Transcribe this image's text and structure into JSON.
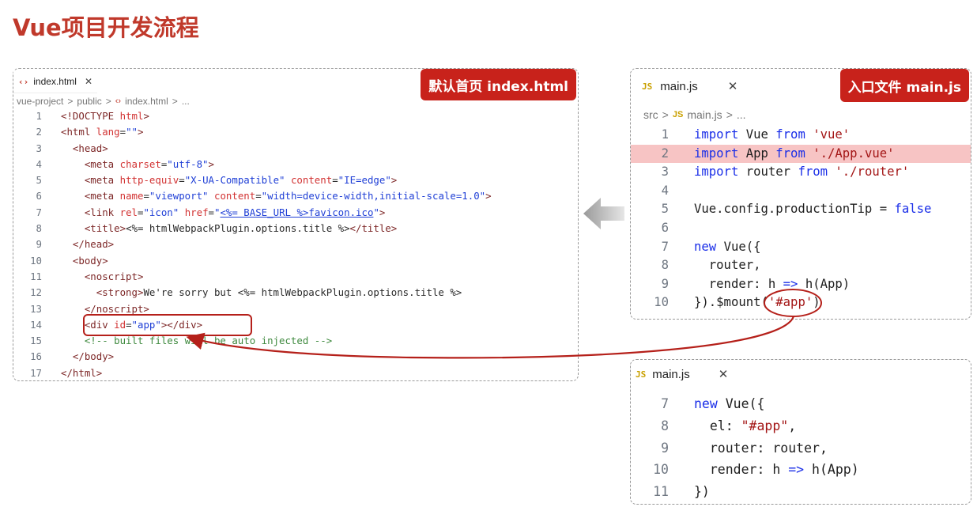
{
  "page_title": "Vue项目开发流程",
  "colors": {
    "accent": "#c8221b",
    "keyword": "#1a2ee8",
    "string": "#a31515",
    "comment": "#3f8a3f",
    "highlight": "#f7c4c4"
  },
  "left_panel": {
    "tab": {
      "icon": "‹›",
      "label": "index.html",
      "close": "✕"
    },
    "badge": "默认首页 index.html",
    "breadcrumb": [
      "vue-project",
      ">",
      "public",
      ">",
      "‹›",
      "index.html",
      ">",
      "..."
    ],
    "lines": [
      {
        "n": "1",
        "parts": [
          {
            "c": "c-tag",
            "t": "<!DOCTYPE "
          },
          {
            "c": "c-attr",
            "t": "html"
          },
          {
            "c": "c-tag",
            "t": ">"
          }
        ]
      },
      {
        "n": "2",
        "parts": [
          {
            "c": "c-tag",
            "t": "<html "
          },
          {
            "c": "c-attr",
            "t": "lang"
          },
          {
            "c": "c-txt",
            "t": "="
          },
          {
            "c": "c-str",
            "t": "\"\""
          },
          {
            "c": "c-tag",
            "t": ">"
          }
        ]
      },
      {
        "n": "3",
        "parts": [
          {
            "c": "c-tag",
            "t": "  <head>"
          }
        ]
      },
      {
        "n": "4",
        "parts": [
          {
            "c": "c-tag",
            "t": "    <meta "
          },
          {
            "c": "c-attr",
            "t": "charset"
          },
          {
            "c": "c-txt",
            "t": "="
          },
          {
            "c": "c-str",
            "t": "\"utf-8\""
          },
          {
            "c": "c-tag",
            "t": ">"
          }
        ]
      },
      {
        "n": "5",
        "parts": [
          {
            "c": "c-tag",
            "t": "    <meta "
          },
          {
            "c": "c-attr",
            "t": "http-equiv"
          },
          {
            "c": "c-txt",
            "t": "="
          },
          {
            "c": "c-str",
            "t": "\"X-UA-Compatible\" "
          },
          {
            "c": "c-attr",
            "t": "content"
          },
          {
            "c": "c-txt",
            "t": "="
          },
          {
            "c": "c-str",
            "t": "\"IE=edge\""
          },
          {
            "c": "c-tag",
            "t": ">"
          }
        ]
      },
      {
        "n": "6",
        "parts": [
          {
            "c": "c-tag",
            "t": "    <meta "
          },
          {
            "c": "c-attr",
            "t": "name"
          },
          {
            "c": "c-txt",
            "t": "="
          },
          {
            "c": "c-str",
            "t": "\"viewport\" "
          },
          {
            "c": "c-attr",
            "t": "content"
          },
          {
            "c": "c-txt",
            "t": "="
          },
          {
            "c": "c-str",
            "t": "\"width=device-width,initial-scale=1.0\""
          },
          {
            "c": "c-tag",
            "t": ">"
          }
        ]
      },
      {
        "n": "7",
        "parts": [
          {
            "c": "c-tag",
            "t": "    <link "
          },
          {
            "c": "c-attr",
            "t": "rel"
          },
          {
            "c": "c-txt",
            "t": "="
          },
          {
            "c": "c-str",
            "t": "\"icon\" "
          },
          {
            "c": "c-attr",
            "t": "href"
          },
          {
            "c": "c-txt",
            "t": "="
          },
          {
            "c": "c-str",
            "t": "\""
          },
          {
            "c": "c-link",
            "t": "<%= BASE_URL %>favicon.ico"
          },
          {
            "c": "c-str",
            "t": "\""
          },
          {
            "c": "c-tag",
            "t": ">"
          }
        ]
      },
      {
        "n": "8",
        "parts": [
          {
            "c": "c-tag",
            "t": "    <title>"
          },
          {
            "c": "c-txt",
            "t": "<%= htmlWebpackPlugin.options.title %>"
          },
          {
            "c": "c-tag",
            "t": "</title>"
          }
        ]
      },
      {
        "n": "9",
        "parts": [
          {
            "c": "c-tag",
            "t": "  </head>"
          }
        ]
      },
      {
        "n": "10",
        "parts": [
          {
            "c": "c-tag",
            "t": "  <body>"
          }
        ]
      },
      {
        "n": "11",
        "parts": [
          {
            "c": "c-tag",
            "t": "    <noscript>"
          }
        ]
      },
      {
        "n": "12",
        "parts": [
          {
            "c": "c-tag",
            "t": "      <strong>"
          },
          {
            "c": "c-txt",
            "t": "We're sorry but <%= htmlWebpackPlugin.options.title %>"
          }
        ]
      },
      {
        "n": "13",
        "parts": [
          {
            "c": "c-tag",
            "t": "    </noscript>"
          }
        ]
      },
      {
        "n": "14",
        "parts": [
          {
            "c": "c-tag",
            "t": "    <div "
          },
          {
            "c": "c-attr",
            "t": "id"
          },
          {
            "c": "c-txt",
            "t": "="
          },
          {
            "c": "c-str",
            "t": "\"app\""
          },
          {
            "c": "c-tag",
            "t": "></div>"
          }
        ]
      },
      {
        "n": "15",
        "parts": [
          {
            "c": "c-cmt",
            "t": "    <!-- built files will be auto injected -->"
          }
        ]
      },
      {
        "n": "16",
        "parts": [
          {
            "c": "c-tag",
            "t": "  </body>"
          }
        ]
      },
      {
        "n": "17",
        "parts": [
          {
            "c": "c-tag",
            "t": "</html>"
          }
        ]
      }
    ]
  },
  "right_panel": {
    "tab": {
      "icon": "JS",
      "label": "main.js",
      "close": "✕"
    },
    "badge": "入口文件 main.js",
    "breadcrumb": [
      "src",
      ">",
      "JS",
      "main.js",
      ">",
      "..."
    ],
    "lines": [
      {
        "n": "1",
        "parts": [
          {
            "c": "c-kw",
            "t": "import "
          },
          {
            "c": "c-id",
            "t": "Vue "
          },
          {
            "c": "c-kw",
            "t": "from "
          },
          {
            "c": "c-s2",
            "t": "'vue'"
          }
        ]
      },
      {
        "n": "2",
        "hl": true,
        "parts": [
          {
            "c": "c-kw",
            "t": "import "
          },
          {
            "c": "c-id",
            "t": "App "
          },
          {
            "c": "c-kw",
            "t": "from "
          },
          {
            "c": "c-s2",
            "t": "'./App.vue'"
          }
        ]
      },
      {
        "n": "3",
        "parts": [
          {
            "c": "c-kw",
            "t": "import "
          },
          {
            "c": "c-id",
            "t": "router "
          },
          {
            "c": "c-kw",
            "t": "from "
          },
          {
            "c": "c-s2",
            "t": "'./router'"
          }
        ]
      },
      {
        "n": "4",
        "parts": []
      },
      {
        "n": "5",
        "parts": [
          {
            "c": "c-id",
            "t": "Vue.config.productionTip = "
          },
          {
            "c": "c-kw",
            "t": "false"
          }
        ]
      },
      {
        "n": "6",
        "parts": []
      },
      {
        "n": "7",
        "parts": [
          {
            "c": "c-kw",
            "t": "new "
          },
          {
            "c": "c-id",
            "t": "Vue({"
          }
        ]
      },
      {
        "n": "8",
        "parts": [
          {
            "c": "c-id",
            "t": "  router,"
          }
        ]
      },
      {
        "n": "9",
        "parts": [
          {
            "c": "c-id",
            "t": "  render: h "
          },
          {
            "c": "c-kw",
            "t": "=>"
          },
          {
            "c": "c-id",
            "t": " h(App)"
          }
        ]
      },
      {
        "n": "10",
        "parts": [
          {
            "c": "c-id",
            "t": "}).$mount("
          },
          {
            "c": "c-s2",
            "t": "'#app'"
          },
          {
            "c": "c-id",
            "t": ")"
          }
        ]
      }
    ]
  },
  "bottom_panel": {
    "tab": {
      "icon": "JS",
      "label": "main.js",
      "close": "✕"
    },
    "lines": [
      {
        "n": "7",
        "parts": [
          {
            "c": "c-kw",
            "t": "new "
          },
          {
            "c": "c-id",
            "t": "Vue({"
          }
        ]
      },
      {
        "n": "8",
        "parts": [
          {
            "c": "c-id",
            "t": "  el: "
          },
          {
            "c": "c-s2",
            "t": "\"#app\""
          },
          {
            "c": "c-id",
            "t": ","
          }
        ]
      },
      {
        "n": "9",
        "parts": [
          {
            "c": "c-id",
            "t": "  router: router,"
          }
        ]
      },
      {
        "n": "10",
        "parts": [
          {
            "c": "c-id",
            "t": "  render: h "
          },
          {
            "c": "c-kw",
            "t": "=>"
          },
          {
            "c": "c-id",
            "t": " h(App)"
          }
        ]
      },
      {
        "n": "11",
        "parts": [
          {
            "c": "c-id",
            "t": "})"
          }
        ]
      }
    ]
  }
}
